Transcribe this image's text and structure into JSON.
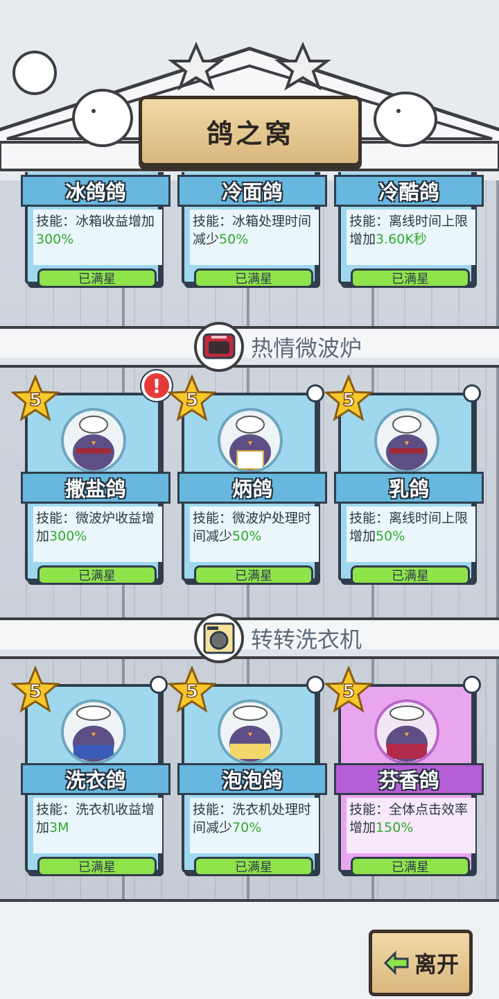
{
  "header": {
    "title": "鸽之窝"
  },
  "top_row": [
    {
      "name": "冰鸽鸽",
      "skill_prefix": "技能：冰箱收益增加",
      "skill_value": "300%",
      "skill_suffix": "",
      "button": "已满星"
    },
    {
      "name": "冷面鸽",
      "skill_prefix": "技能：冰箱处理时间减少",
      "skill_value": "50%",
      "skill_suffix": "",
      "button": "已满星"
    },
    {
      "name": "冷酷鸽",
      "skill_prefix": "技能：离线时间上限增加",
      "skill_value": "3.60K秒",
      "skill_suffix": "",
      "button": "已满星"
    }
  ],
  "sections": [
    {
      "title": "热情微波炉",
      "icon": "microwave-icon",
      "cards": [
        {
          "name": "撒盐鸽",
          "stars": "5",
          "skill_prefix": "技能：微波炉收益增加",
          "skill_value": "300%",
          "button": "已满星",
          "alert": "!"
        },
        {
          "name": "炳鸽",
          "stars": "5",
          "skill_prefix": "技能：微波炉处理时间减少",
          "skill_value": "50%",
          "button": "已满星"
        },
        {
          "name": "乳鸽",
          "stars": "5",
          "skill_prefix": "技能：离线时间上限增加",
          "skill_value": "50%",
          "button": "已满星"
        }
      ]
    },
    {
      "title": "转转洗衣机",
      "icon": "washing-machine-icon",
      "cards": [
        {
          "name": "洗衣鸽",
          "stars": "5",
          "skill_prefix": "技能：洗衣机收益增加",
          "skill_value": "3M",
          "button": "已满星"
        },
        {
          "name": "泡泡鸽",
          "stars": "5",
          "skill_prefix": "技能：洗衣机处理时间减少",
          "skill_value": "70%",
          "button": "已满星"
        },
        {
          "name": "芬香鸽",
          "stars": "5",
          "skill_prefix": "技能：全体点击效率增加",
          "skill_value": "150%",
          "button": "已满星"
        }
      ]
    }
  ],
  "footer": {
    "leave_label": "离开"
  },
  "colors": {
    "card_blue": "#9fd8ee",
    "card_pink": "#e9a6ef",
    "value_green": "#2faa2a",
    "button_green": "#8fe34b"
  }
}
